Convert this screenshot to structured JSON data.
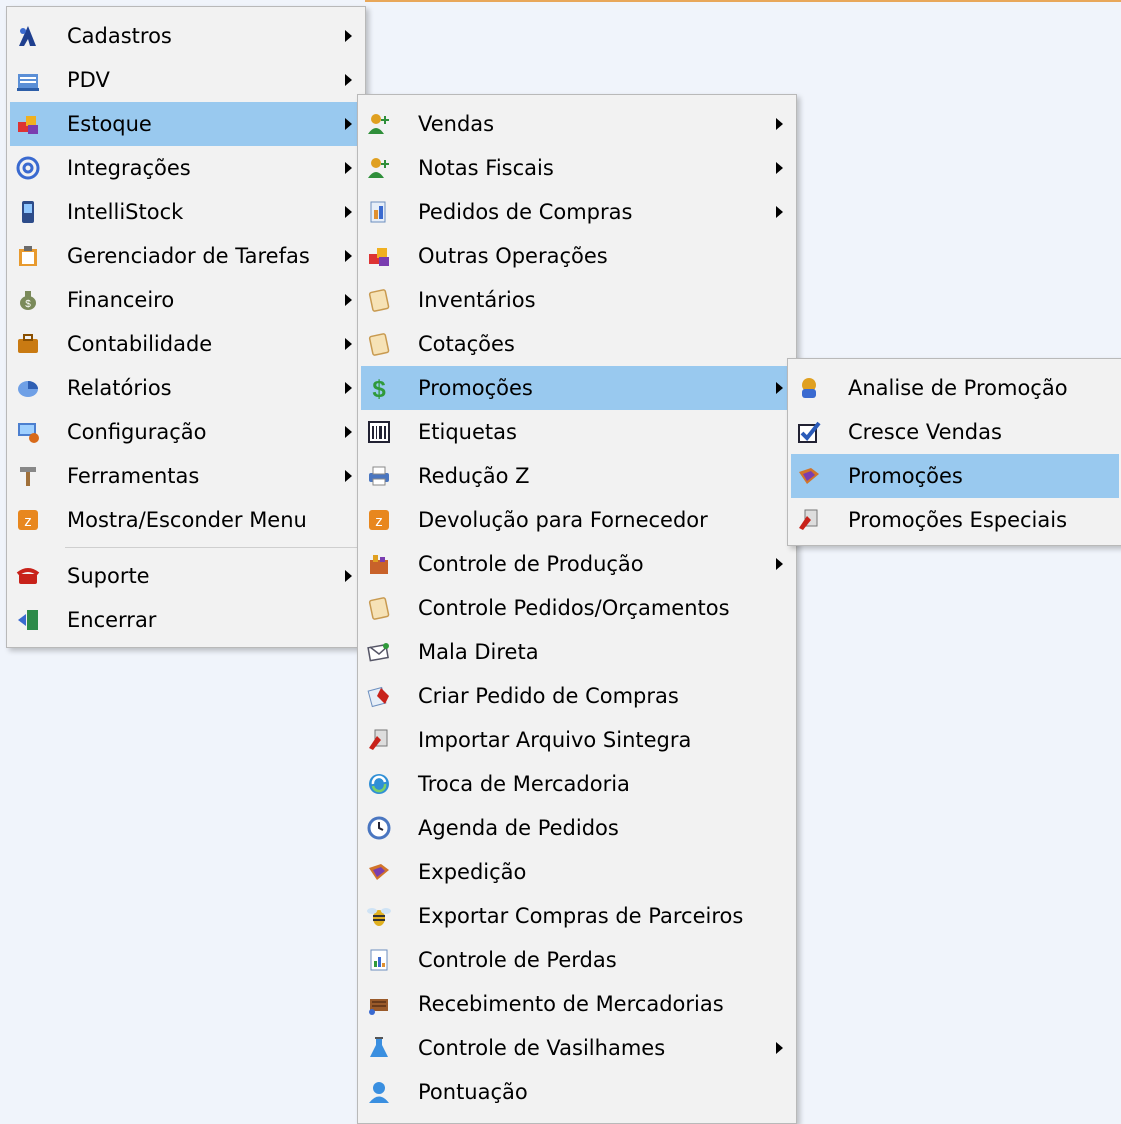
{
  "colors": {
    "highlight": "#99c9ef",
    "menu_bg": "#f2f2f2",
    "accent_line": "#e8a75a"
  },
  "main_menu": [
    {
      "label": "Cadastros",
      "icon": "user-search-icon",
      "submenu": true
    },
    {
      "label": "PDV",
      "icon": "cash-register-icon",
      "submenu": true
    },
    {
      "label": "Estoque",
      "icon": "stock-boxes-icon",
      "submenu": true,
      "highlighted": true
    },
    {
      "label": "Integrações",
      "icon": "at-sign-icon",
      "submenu": true
    },
    {
      "label": "IntelliStock",
      "icon": "handheld-device-icon",
      "submenu": true
    },
    {
      "label": "Gerenciador de Tarefas",
      "icon": "clipboard-icon",
      "submenu": true
    },
    {
      "label": "Financeiro",
      "icon": "money-bag-icon",
      "submenu": true
    },
    {
      "label": "Contabilidade",
      "icon": "briefcase-icon",
      "submenu": true
    },
    {
      "label": "Relatórios",
      "icon": "pie-chart-icon",
      "submenu": true
    },
    {
      "label": "Configuração",
      "icon": "settings-computer-icon",
      "submenu": true
    },
    {
      "label": "Ferramentas",
      "icon": "hammer-icon",
      "submenu": true
    },
    {
      "label": "Mostra/Esconder Menu",
      "icon": "toggle-menu-icon",
      "submenu": false
    },
    {
      "label": "Suporte",
      "icon": "telephone-icon",
      "submenu": true
    },
    {
      "label": "Encerrar",
      "icon": "exit-door-icon",
      "submenu": false
    }
  ],
  "estoque_menu": [
    {
      "label": "Vendas",
      "icon": "person-add-icon",
      "submenu": true
    },
    {
      "label": "Notas Fiscais",
      "icon": "person-add-icon",
      "submenu": true
    },
    {
      "label": "Pedidos de Compras",
      "icon": "purchase-order-icon",
      "submenu": true
    },
    {
      "label": "Outras Operações",
      "icon": "stock-boxes-icon",
      "submenu": false
    },
    {
      "label": "Inventários",
      "icon": "note-pad-icon",
      "submenu": false
    },
    {
      "label": "Cotações",
      "icon": "note-pad-icon",
      "submenu": false
    },
    {
      "label": "Promoções",
      "icon": "dollar-sign-icon",
      "submenu": true,
      "highlighted": true
    },
    {
      "label": "Etiquetas",
      "icon": "barcode-label-icon",
      "submenu": false
    },
    {
      "label": "Redução Z",
      "icon": "printer-icon",
      "submenu": false
    },
    {
      "label": "Devolução para Fornecedor",
      "icon": "return-icon",
      "submenu": false
    },
    {
      "label": "Controle de Produção",
      "icon": "production-icon",
      "submenu": true
    },
    {
      "label": "Controle Pedidos/Orçamentos",
      "icon": "note-pad-icon",
      "submenu": false
    },
    {
      "label": "Mala Direta",
      "icon": "mail-icon",
      "submenu": false
    },
    {
      "label": "Criar Pedido de Compras",
      "icon": "create-order-icon",
      "submenu": false
    },
    {
      "label": "Importar Arquivo Sintegra",
      "icon": "import-file-icon",
      "submenu": false
    },
    {
      "label": "Troca de Mercadoria",
      "icon": "exchange-icon",
      "submenu": false
    },
    {
      "label": "Agenda de Pedidos",
      "icon": "clock-icon",
      "submenu": false
    },
    {
      "label": "Expedição",
      "icon": "shipping-icon",
      "submenu": false
    },
    {
      "label": "Exportar Compras de Parceiros",
      "icon": "bee-icon",
      "submenu": false
    },
    {
      "label": "Controle de Perdas",
      "icon": "report-chart-icon",
      "submenu": false
    },
    {
      "label": "Recebimento de Mercadorias",
      "icon": "goods-receipt-icon",
      "submenu": false
    },
    {
      "label": "Controle de Vasilhames",
      "icon": "flask-icon",
      "submenu": true
    },
    {
      "label": "Pontuação",
      "icon": "user-icon",
      "submenu": false
    }
  ],
  "promocoes_menu": [
    {
      "label": "Analise de Promoção",
      "icon": "analysis-icon",
      "submenu": false
    },
    {
      "label": "Cresce Vendas",
      "icon": "checkbox-icon",
      "submenu": false
    },
    {
      "label": "Promoções",
      "icon": "promotion-tag-icon",
      "submenu": false,
      "highlighted": true
    },
    {
      "label": "Promoções Especiais",
      "icon": "special-promotion-icon",
      "submenu": false
    }
  ]
}
